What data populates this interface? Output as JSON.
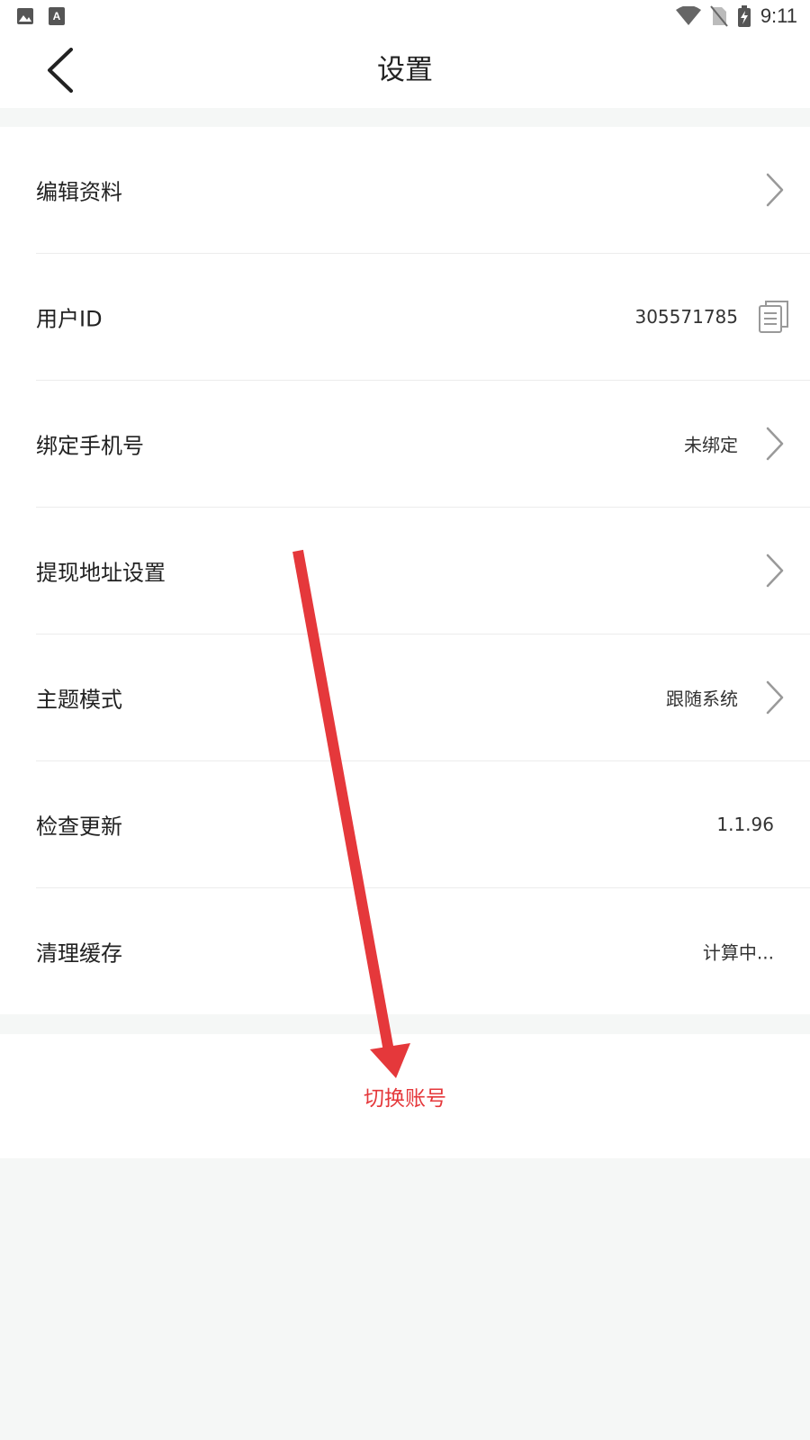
{
  "status_bar": {
    "time": "9:11",
    "left_icons": [
      "image-icon",
      "keyboard-a-icon"
    ],
    "right_icons": [
      "wifi-icon",
      "no-sim-icon",
      "battery-charging-icon"
    ]
  },
  "header": {
    "title": "设置",
    "back_icon": "chevron-left-icon"
  },
  "settings": {
    "items": [
      {
        "label": "编辑资料",
        "value": "",
        "trailing": "chevron"
      },
      {
        "label": "用户ID",
        "value": "305571785",
        "trailing": "copy"
      },
      {
        "label": "绑定手机号",
        "value": "未绑定",
        "trailing": "chevron"
      },
      {
        "label": "提现地址设置",
        "value": "",
        "trailing": "chevron"
      },
      {
        "label": "主题模式",
        "value": "跟随系统",
        "trailing": "chevron"
      },
      {
        "label": "检查更新",
        "value": "1.1.96",
        "trailing": "none"
      },
      {
        "label": "清理缓存",
        "value": "计算中...",
        "trailing": "none"
      }
    ]
  },
  "actions": {
    "switch_account_label": "切换账号"
  },
  "colors": {
    "accent_red": "#e5383b",
    "background": "#f5f7f6",
    "surface": "#ffffff",
    "divider": "#ececec"
  }
}
